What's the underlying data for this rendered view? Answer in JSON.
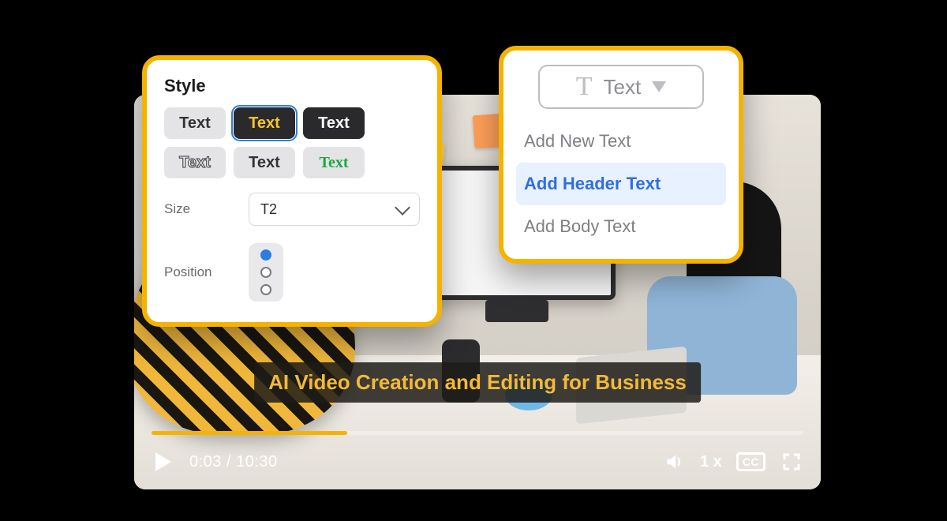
{
  "video": {
    "caption": "AI Video Creation and Editing for Business",
    "time_current": "0:03",
    "time_total": "10:30",
    "speed": "1 x",
    "cc": "CC",
    "progress_percent": 30
  },
  "style_panel": {
    "title": "Style",
    "swatches": [
      "Text",
      "Text",
      "Text",
      "Text",
      "Text",
      "Text"
    ],
    "selected_swatch_index": 1,
    "size_label": "Size",
    "size_value": "T2",
    "position_label": "Position",
    "position_options": [
      "top",
      "middle",
      "bottom"
    ],
    "position_selected_index": 0
  },
  "text_popover": {
    "trigger_label": "Text",
    "items": [
      "Add New Text",
      "Add Header Text",
      "Add Body Text"
    ],
    "active_index": 1
  }
}
